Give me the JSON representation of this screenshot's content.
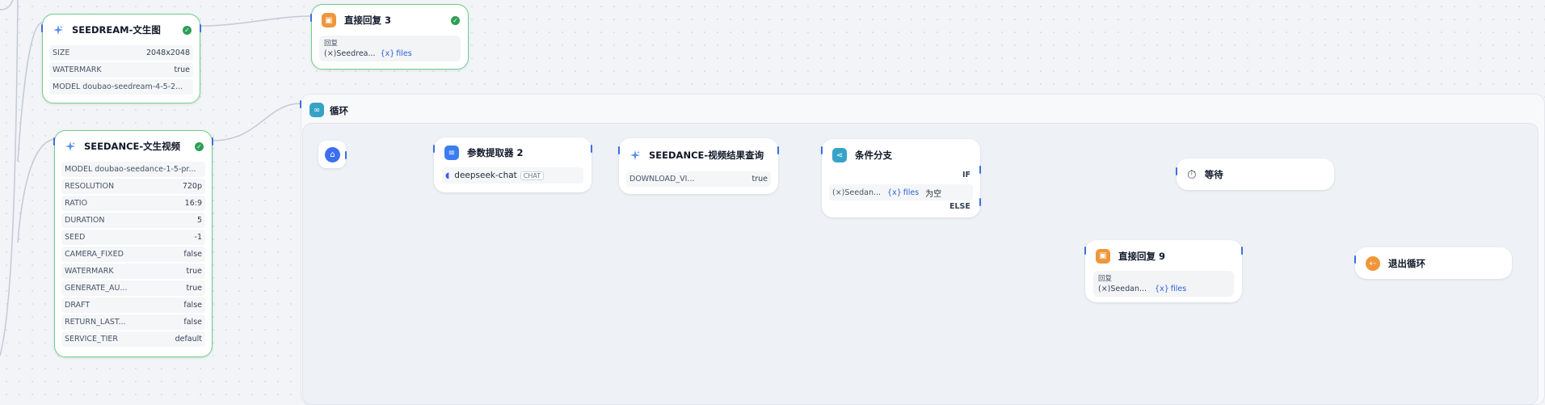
{
  "colors": {
    "success": "#2e9d55",
    "port": "#3d6fe0",
    "reply_icon": "#f0963a",
    "param_icon": "#3c7ef0",
    "loop_icon": "#36a3c6",
    "files_link": "#2b5fd9"
  },
  "icons": {
    "seedream": "spark-icon",
    "seedance": "spark-icon",
    "reply": "reply-icon",
    "param": "param-extractor-icon",
    "deepseek": "whale-icon",
    "branch": "branch-icon",
    "wait": "timer-icon",
    "exit": "exit-icon",
    "loop": "infinity-icon",
    "start": "home-icon"
  },
  "seedream": {
    "title": "SEEDREAM-文生图",
    "rows": [
      {
        "k": "SIZE",
        "v": "2048x2048"
      },
      {
        "k": "WATERMARK",
        "v": "true"
      },
      {
        "k": "MODEL doubao-seedream-4-5-2...",
        "v": ""
      }
    ]
  },
  "reply3": {
    "title": "直接回复 3",
    "label": "回复",
    "var": "Seedrea...",
    "files": "files"
  },
  "seedance": {
    "title": "SEEDANCE-文生视频",
    "rows": [
      {
        "k": "MODEL doubao-seedance-1-5-pr...",
        "v": ""
      },
      {
        "k": "RESOLUTION",
        "v": "720p"
      },
      {
        "k": "RATIO",
        "v": "16:9"
      },
      {
        "k": "DURATION",
        "v": "5"
      },
      {
        "k": "SEED",
        "v": "-1"
      },
      {
        "k": "CAMERA_FIXED",
        "v": "false"
      },
      {
        "k": "WATERMARK",
        "v": "true"
      },
      {
        "k": "GENERATE_AU...",
        "v": "true"
      },
      {
        "k": "DRAFT",
        "v": "false"
      },
      {
        "k": "RETURN_LAST...",
        "v": "false"
      },
      {
        "k": "SERVICE_TIER",
        "v": "default"
      }
    ]
  },
  "loop": {
    "title": "循环"
  },
  "param": {
    "title": "参数提取器 2",
    "model": "deepseek-chat",
    "badge": "CHAT"
  },
  "query": {
    "title": "SEEDANCE-视频结果查询",
    "row_k": "DOWNLOAD_VI...",
    "row_v": "true"
  },
  "branch": {
    "title": "条件分支",
    "if_label": "IF",
    "else_label": "ELSE",
    "var": "Seedan...",
    "files": "files",
    "op": "为空"
  },
  "wait": {
    "title": "等待"
  },
  "reply9": {
    "title": "直接回复 9",
    "label": "回复",
    "var": "Seedan...",
    "files": "files"
  },
  "exit": {
    "title": "退出循环"
  }
}
